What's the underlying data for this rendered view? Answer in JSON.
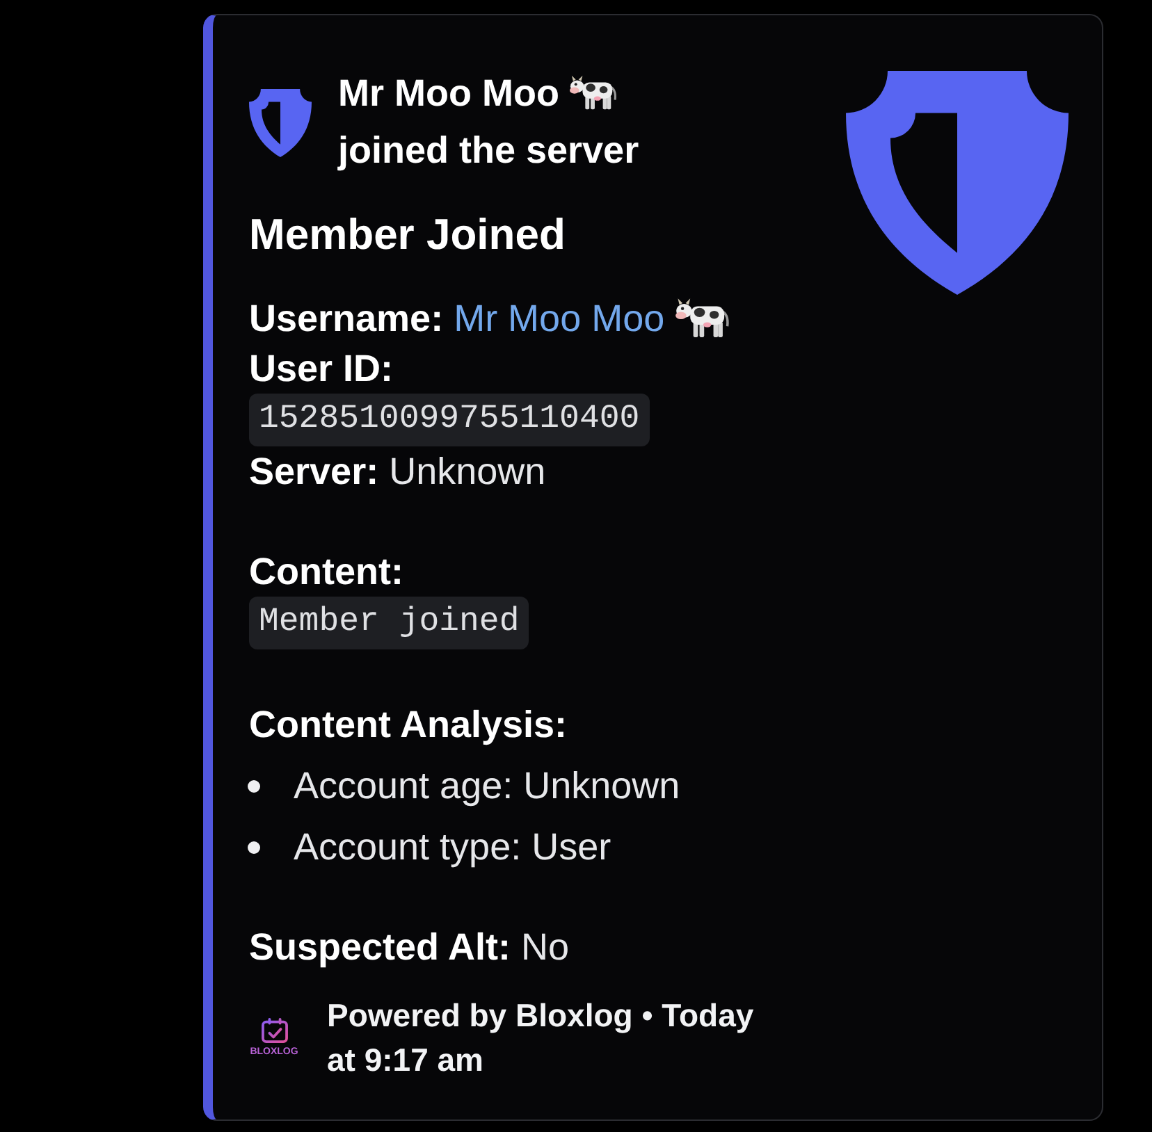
{
  "embed": {
    "author": {
      "name": "Mr Moo Moo",
      "action": "joined the server"
    },
    "title": "Member Joined",
    "sections": [
      {
        "lines": [
          {
            "kind": "mention",
            "label": "Username:",
            "value": "Mr Moo Moo"
          },
          {
            "kind": "label",
            "label": "User ID:"
          },
          {
            "kind": "code",
            "value": "1528510099755110400"
          },
          {
            "kind": "field",
            "text": "**Server:** Unknown"
          }
        ]
      },
      {
        "lines": [
          {
            "kind": "label",
            "label": "Content:"
          },
          {
            "kind": "code",
            "value": "Member joined"
          }
        ]
      },
      {
        "lines": [
          {
            "kind": "label",
            "label": "Content Analysis:"
          },
          {
            "kind": "bullet",
            "text": "Account age: Unknown"
          },
          {
            "kind": "bullet",
            "text": "Account type: User"
          }
        ]
      },
      {
        "lines": [
          {
            "kind": "field",
            "text": "**Suspected Alt:** No"
          }
        ]
      }
    ],
    "footer": {
      "logo_text": "BLOXLOG",
      "text": "Powered by Bloxlog • Today at 9:17 am"
    }
  }
}
